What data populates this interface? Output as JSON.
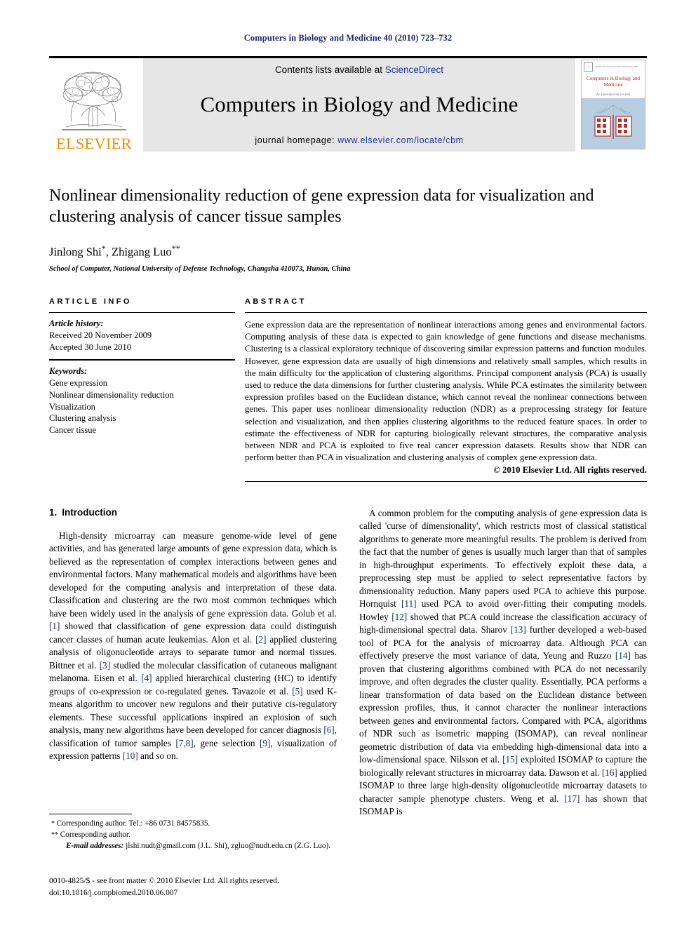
{
  "running_head": "Computers in Biology and Medicine 40 (2010) 723–732",
  "masthead": {
    "publisher_name": "ELSEVIER",
    "contents_prefix": "Contents lists available at ",
    "contents_link": "ScienceDirect",
    "journal_title": "Computers in Biology and Medicine",
    "homepage_prefix": "journal homepage: ",
    "homepage_link": "www.elsevier.com/locate/cbm",
    "cover": {
      "title": "Computers in Biology and Medicine",
      "subtitle": "An International Journal",
      "meta": "Volume 38   Issue 6   April 2010   ISSN 0010-4825",
      "accent_color": "#b22222",
      "panel_color": "#b8cde0"
    },
    "band_color": "#e6e6e6",
    "elsevier_orange": "#ED8B00"
  },
  "article": {
    "title": "Nonlinear dimensionality reduction of gene expression data for visualization and clustering analysis of cancer tissue samples",
    "authors": "Jinlong Shi, Zhigang Luo",
    "author1": "Jinlong Shi",
    "author1_mark": "*",
    "author2": "Zhigang Luo",
    "author2_mark": "**",
    "affiliation": "School of Computer, National University of Defense Technology, Changsha 410073, Hunan, China"
  },
  "article_info": {
    "heading": "ARTICLE INFO",
    "history_label": "Article history:",
    "history": [
      "Received 20 November 2009",
      "Accepted 30 June 2010"
    ],
    "keywords_label": "Keywords:",
    "keywords": [
      "Gene expression",
      "Nonlinear dimensionality reduction",
      "Visualization",
      "Clustering analysis",
      "Cancer tissue"
    ]
  },
  "abstract": {
    "heading": "ABSTRACT",
    "text": "Gene expression data are the representation of nonlinear interactions among genes and environmental factors. Computing analysis of these data is expected to gain knowledge of gene functions and disease mechanisms. Clustering is a classical exploratory technique of discovering similar expression patterns and function modules. However, gene expression data are usually of high dimensions and relatively small samples, which results in the main difficulty for the application of clustering algorithms. Principal component analysis (PCA) is usually used to reduce the data dimensions for further clustering analysis. While PCA estimates the similarity between expression profiles based on the Euclidean distance, which cannot reveal the nonlinear connections between genes. This paper uses nonlinear dimensionality reduction (NDR) as a preprocessing strategy for feature selection and visualization, and then applies clustering algorithms to the reduced feature spaces. In order to estimate the effectiveness of NDR for capturing biologically relevant structures, the comparative analysis between NDR and PCA is exploited to five real cancer expression datasets. Results show that NDR can perform better than PCA in visualization and clustering analysis of complex gene expression data.",
    "copyright": "© 2010 Elsevier Ltd. All rights reserved."
  },
  "introduction": {
    "number": "1.",
    "heading": "Introduction",
    "left_paragraph_1": "High-density microarray can measure genome-wide level of gene activities, and has generated large amounts of gene expression data, which is believed as the representation of complex interactions between genes and environmental factors. Many mathematical models and algorithms have been developed for the computing analysis and interpretation of these data. Classification and clustering are the two most common techniques which have been widely used in the analysis of gene expression data. Golub et al. [1] showed that classification of gene expression data could distinguish cancer classes of human acute leukemias. Alon et al. [2] applied clustering analysis of oligonucleotide arrays to separate tumor and normal tissues. Bittner et al. [3] studied the molecular classification of cutaneous malignant melanoma. Eisen et al. [4] applied hierarchical clustering (HC) to identify groups of co-expression or co-regulated genes. Tavazoie et al. [5] used K-means algorithm to uncover new regulons and their putative cis-regulatory elements. These successful applications inspired an explosion of such analysis, many new algorithms have been developed for cancer diagnosis [6], classification of tumor samples [7,8], gene selection [9], visualization of expression patterns [10] and so on.",
    "right_paragraph_1": "A common problem for the computing analysis of gene expression data is called 'curse of dimensionality', which restricts most of classical statistical algorithms to generate more meaningful results. The problem is derived from the fact that the number of genes is usually much larger than that of samples in high-throughput experiments. To effectively exploit these data, a preprocessing step must be applied to select representative factors by dimensionality reduction. Many papers used PCA to achieve this purpose. Hornquist [11] used PCA to avoid over-fitting their computing models. Howley [12] showed that PCA could increase the classification accuracy of high-dimensional spectral data. Sharov [13] further developed a web-based tool of PCA for the analysis of microarray data. Although PCA can effectively preserve the most variance of data, Yeung and Ruzzo [14] has proven that clustering algorithms combined with PCA do not necessarily improve, and often degrades the cluster quality. Essentially, PCA performs a linear transformation of data based on the Euclidean distance between expression profiles, thus, it cannot character the nonlinear interactions between genes and environmental factors. Compared with PCA, algorithms of NDR such as isometric mapping (ISOMAP), can reveal nonlinear geometric distribution of data via embedding high-dimensional data into a low-dimensional space. Nilsson et al. [15] exploited ISOMAP to capture the biologically relevant structures in microarray data. Dawson et al. [16] applied ISOMAP to three large high-density oligonucleotide microarray datasets to character sample phenotype clusters. Weng et al. [17] has shown that ISOMAP is"
  },
  "footnotes": {
    "line1": "Corresponding author. Tel.: +86 0731 84575835.",
    "line1_mark": "*",
    "line2": "Corresponding author.",
    "line2_mark": "**",
    "email_label": "E-mail addresses:",
    "email_text": "jlshi.nudt@gmail.com (J.L. Shi), zgluo@nudt.edu.cn (Z.G. Luo)."
  },
  "imprint": {
    "line1": "0010-4825/$ - see front matter © 2010 Elsevier Ltd. All rights reserved.",
    "line2": "doi:10.1016/j.compbiomed.2010.06.007"
  }
}
